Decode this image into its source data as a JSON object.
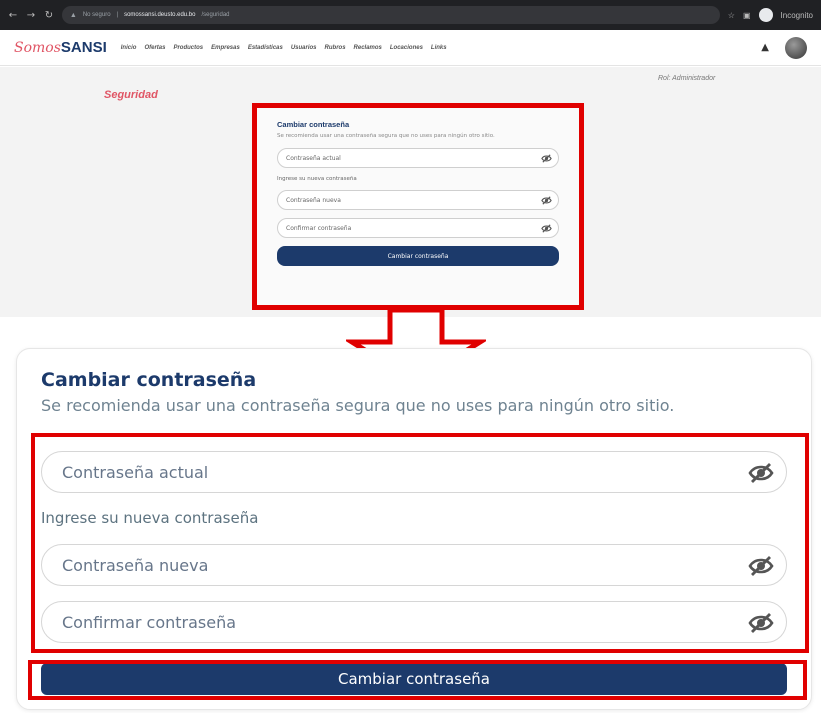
{
  "browser": {
    "url_prefix": "No seguro",
    "url_host": "somossansi.deusto.edu.bo",
    "url_path": "/seguridad",
    "incognito_label": "Incognito",
    "back_icon": "arrow-left-icon",
    "forward_icon": "arrow-right-icon",
    "reload_icon": "reload-icon"
  },
  "site": {
    "logo_script": "Somos",
    "logo_bold": "SANSI",
    "menu": [
      "Inicio",
      "Ofertas",
      "Productos",
      "Empresas",
      "Estadísticas",
      "Usuarios",
      "Rubros",
      "Reclamos",
      "Locaciones",
      "Links"
    ],
    "role": "Rol: Administrador",
    "section_title": "Seguridad"
  },
  "form": {
    "title": "Cambiar contraseña",
    "description": "Se recomienda usar una contraseña segura que no uses para ningún otro sitio.",
    "current_placeholder": "Contraseña actual",
    "new_label": "Ingrese su nueva contraseña",
    "new_placeholder": "Contraseña nueva",
    "confirm_placeholder": "Confirmar contraseña",
    "submit_label": "Cambiar contraseña"
  },
  "colors": {
    "brand_navy": "#1c3a6b",
    "brand_pink": "#e05565",
    "highlight_red": "#e00000"
  }
}
